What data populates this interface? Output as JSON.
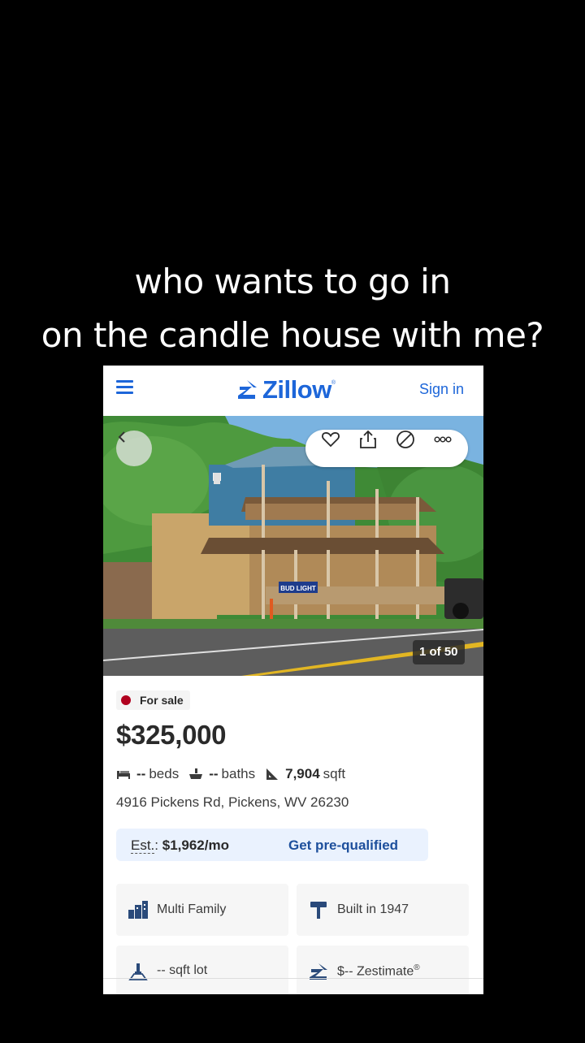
{
  "caption": {
    "line1": "who wants to go in",
    "line2": "on the candle house with me?"
  },
  "header": {
    "logo_text": "Zillow",
    "sign_in": "Sign in",
    "brand_color": "#1d66d9"
  },
  "photo": {
    "counter": "1 of 50",
    "sign_text": "BUD LIGHT",
    "icons": [
      "back-chevron-icon",
      "heart-icon",
      "share-icon",
      "hide-icon",
      "more-icon"
    ]
  },
  "listing": {
    "status": "For sale",
    "status_color": "#b0001e",
    "price": "$325,000",
    "beds_value": "--",
    "beds_label": "beds",
    "baths_value": "--",
    "baths_label": "baths",
    "sqft_value": "7,904",
    "sqft_label": "sqft",
    "address": "4916 Pickens Rd, Pickens, WV 26230"
  },
  "estimate": {
    "label": "Est.",
    "colon": ":",
    "amount": "$1,962/mo",
    "cta": "Get pre-qualified"
  },
  "tiles": [
    {
      "text": "Multi Family",
      "icon": "building-icon"
    },
    {
      "text": "Built in 1947",
      "icon": "hammer-icon"
    },
    {
      "text": "-- sqft lot",
      "icon": "lot-icon"
    },
    {
      "text": "$-- Zestimate",
      "sup": "®",
      "icon": "zestimate-icon"
    }
  ]
}
